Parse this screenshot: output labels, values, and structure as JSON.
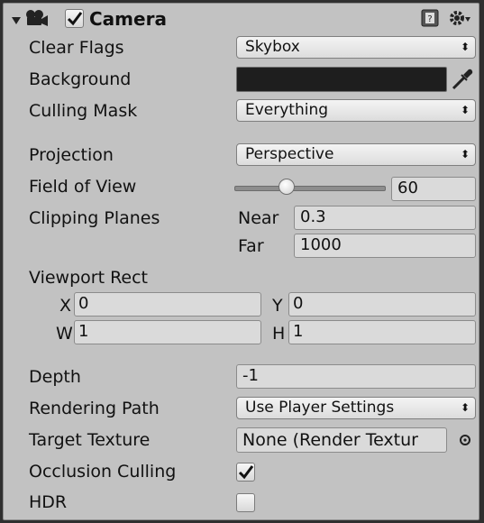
{
  "component": {
    "title": "Camera",
    "enabled": true,
    "foldout_icon": "foldout-arrow-icon",
    "camera_icon": "camera-icon",
    "help_icon": "help-book-icon",
    "settings_icon": "gear-icon"
  },
  "fields": {
    "clear_flags": {
      "label": "Clear Flags",
      "value": "Skybox"
    },
    "background": {
      "label": "Background",
      "color": "#1e1e1e",
      "picker_icon": "eyedropper-icon"
    },
    "culling_mask": {
      "label": "Culling Mask",
      "value": "Everything"
    },
    "projection": {
      "label": "Projection",
      "value": "Perspective"
    },
    "field_of_view": {
      "label": "Field of View",
      "value": "60",
      "slider_fraction": 0.33
    },
    "clipping_planes": {
      "label": "Clipping Planes",
      "near_label": "Near",
      "near": "0.3",
      "far_label": "Far",
      "far": "1000"
    },
    "viewport_rect": {
      "label": "Viewport Rect",
      "x_label": "X",
      "x": "0",
      "y_label": "Y",
      "y": "0",
      "w_label": "W",
      "w": "1",
      "h_label": "H",
      "h": "1"
    },
    "depth": {
      "label": "Depth",
      "value": "-1"
    },
    "rendering_path": {
      "label": "Rendering Path",
      "value": "Use Player Settings"
    },
    "target_texture": {
      "label": "Target Texture",
      "value": "None (Render Textur",
      "picker_icon": "object-picker-icon"
    },
    "occlusion_culling": {
      "label": "Occlusion Culling",
      "checked": true
    },
    "hdr": {
      "label": "HDR",
      "checked": false
    }
  }
}
